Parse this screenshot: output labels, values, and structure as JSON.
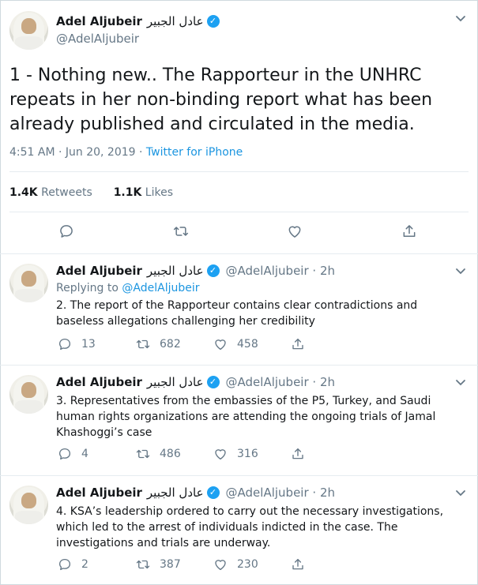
{
  "main": {
    "name": "Adel Aljubeir",
    "name_ar": "عادل الجبير",
    "handle": "@AdelAljubeir",
    "text": "1 - Nothing new.. The Rapporteur in the UNHRC repeats in her non-binding report what has been already published and circulated in the media.",
    "timestamp": "4:51 AM · Jun 20, 2019 · ",
    "source": "Twitter for iPhone",
    "retweets_count": "1.4K",
    "retweets_label": "Retweets",
    "likes_count": "1.1K",
    "likes_label": "Likes"
  },
  "replies": [
    {
      "name": "Adel Aljubeir",
      "name_ar": "عادل الجبير",
      "handle_time": "@AdelAljubeir · 2h",
      "replying_prefix": "Replying to ",
      "replying_handle": "@AdelAljubeir",
      "text": "2. The report of the Rapporteur contains clear contradictions and baseless allegations challenging her credibility",
      "replies": "13",
      "retweets": "682",
      "likes": "458"
    },
    {
      "name": "Adel Aljubeir",
      "name_ar": "عادل الجبير",
      "handle_time": "@AdelAljubeir · 2h",
      "text": "3. Representatives from the embassies of the P5, Turkey, and Saudi human rights organizations are attending the ongoing trials of Jamal Khashoggi’s case",
      "replies": "4",
      "retweets": "486",
      "likes": "316"
    },
    {
      "name": "Adel Aljubeir",
      "name_ar": "عادل الجبير",
      "handle_time": "@AdelAljubeir · 2h",
      "text": "4. KSA’s leadership ordered to carry out the necessary investigations, which led to the arrest of individuals indicted in the case. The investigations and trials are underway.",
      "replies": "2",
      "retweets": "387",
      "likes": "230"
    }
  ],
  "icons": {
    "verified": "✓",
    "chevron": "⌄"
  },
  "colors": {
    "accent": "#1da1f2",
    "link": "#1b95e0",
    "muted": "#657786",
    "divider": "#e6ecf0"
  }
}
